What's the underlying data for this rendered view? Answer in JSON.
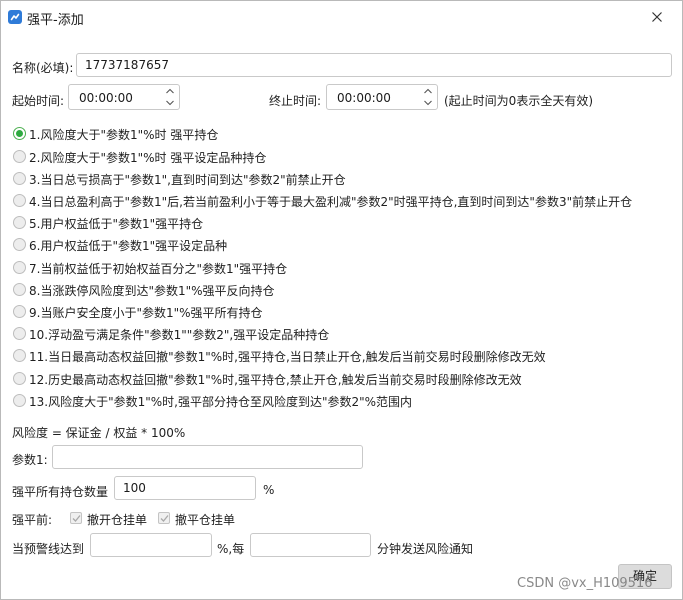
{
  "window": {
    "title": "强平-添加",
    "icon": "app-icon",
    "close_icon": "close-icon"
  },
  "name_field": {
    "label": "名称(必填):",
    "value": "17737187657"
  },
  "time": {
    "start_label": "起始时间:",
    "start_value": "00:00:00",
    "end_label": "终止时间:",
    "end_value": "00:00:00",
    "note": "(起止时间为0表示全天有效)"
  },
  "conditions": {
    "selected_index": 0,
    "options": [
      "1.风险度大于\"参数1\"%时 强平持仓",
      "2.风险度大于\"参数1\"%时 强平设定品种持仓",
      "3.当日总亏损高于\"参数1\",直到时间到达\"参数2\"前禁止开仓",
      "4.当日总盈利高于\"参数1\"后,若当前盈利小于等于最大盈利减\"参数2\"时强平持仓,直到时间到达\"参数3\"前禁止开仓",
      "5.用户权益低于\"参数1\"强平持仓",
      "6.用户权益低于\"参数1\"强平设定品种",
      "7.当前权益低于初始权益百分之\"参数1\"强平持仓",
      "8.当涨跌停风险度到达\"参数1\"%强平反向持仓",
      "9.当账户安全度小于\"参数1\"%强平所有持仓",
      "10.浮动盈亏满足条件\"参数1\"\"参数2\",强平设定品种持仓",
      "11.当日最高动态权益回撤\"参数1\"%时,强平持仓,当日禁止开仓,触发后当前交易时段删除修改无效",
      "12.历史最高动态权益回撤\"参数1\"%时,强平持仓,禁止开仓,触发后当前交易时段删除修改无效",
      "13.风险度大于\"参数1\"%时,强平部分持仓至风险度到达\"参数2\"%范围内"
    ]
  },
  "formula": "风险度 = 保证金 / 权益 * 100%",
  "param1": {
    "label": "参数1:",
    "value": ""
  },
  "close_qty": {
    "label": "强平所有持仓数量",
    "value": "100",
    "unit": "%"
  },
  "before_close": {
    "label": "强平前:",
    "cancel_open_label": "撤开仓挂单",
    "cancel_open_checked": true,
    "cancel_close_label": "撤平仓挂单",
    "cancel_close_checked": true
  },
  "warning": {
    "label": "当预警线达到",
    "value1": "",
    "mid_label": "%,每",
    "value2": "",
    "suffix": "分钟发送风险通知"
  },
  "ok_button": "确定",
  "watermark": "CSDN @vx_H109516",
  "colors": {
    "radio_selected": "#2eaa40",
    "button_bg": "#dcdcdc",
    "border": "#c9c9c9"
  }
}
